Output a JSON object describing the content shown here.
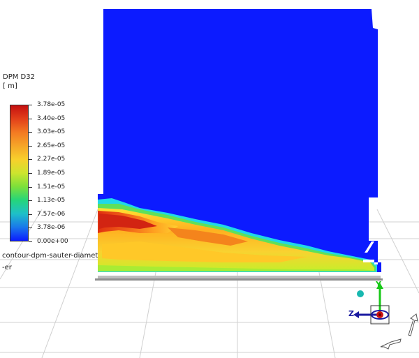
{
  "legend": {
    "title_line1": "DPM D32",
    "title_line2": "[ m]",
    "labels": [
      "3.78e-05",
      "3.40e-05",
      "3.03e-05",
      "2.65e-05",
      "2.27e-05",
      "1.89e-05",
      "1.51e-05",
      "1.13e-05",
      "7.57e-06",
      "3.78e-06",
      "0.00e+00"
    ]
  },
  "caption": {
    "line1": "contour-dpm-sauter-diamet",
    "line2": "-er"
  },
  "triad": {
    "y_label": "Y",
    "z_label": "Z"
  },
  "colors": {
    "background": "#ffffff",
    "domain_fill": "#0c1bff",
    "floor_grid": "#d3d3d3",
    "accent_green": "#18c818",
    "accent_red": "#cc1010"
  }
}
